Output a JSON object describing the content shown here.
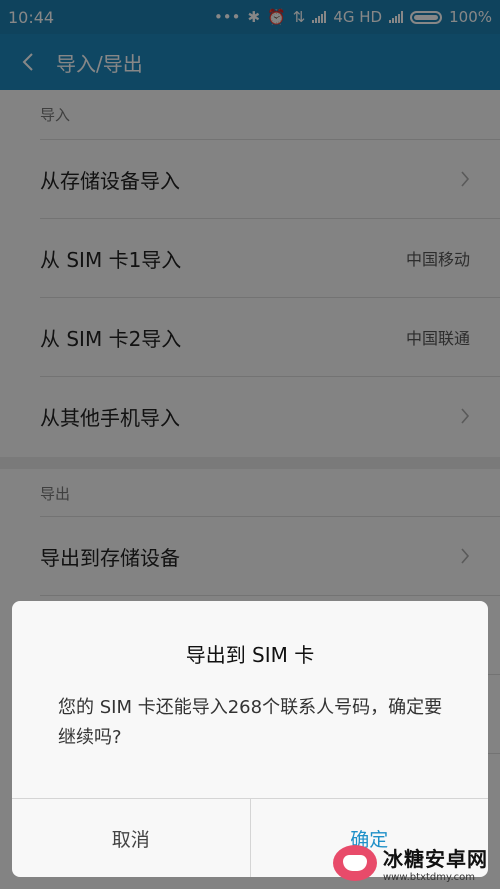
{
  "status": {
    "time": "10:44",
    "dots": "•••",
    "network": "4G HD",
    "battery": "100%"
  },
  "appbar": {
    "title": "导入/导出"
  },
  "import": {
    "label": "导入",
    "items": [
      {
        "label": "从存储设备导入",
        "sub": ""
      },
      {
        "label": "从 SIM 卡1导入",
        "sub": "中国移动"
      },
      {
        "label": "从 SIM 卡2导入",
        "sub": "中国联通"
      },
      {
        "label": "从其他手机导入",
        "sub": ""
      }
    ]
  },
  "export": {
    "label": "导出",
    "items": [
      {
        "label": "导出到存储设备"
      }
    ]
  },
  "dialog": {
    "title": "导出到 SIM 卡",
    "message": "您的 SIM 卡还能导入268个联系人号码，确定要继续吗?",
    "cancel": "取消",
    "confirm": "确定"
  },
  "watermark": {
    "name": "冰糖安卓网",
    "url": "www.btxtdmy.com"
  },
  "colors": {
    "appbar": "#1e86bb",
    "accent": "#1e90c8"
  }
}
